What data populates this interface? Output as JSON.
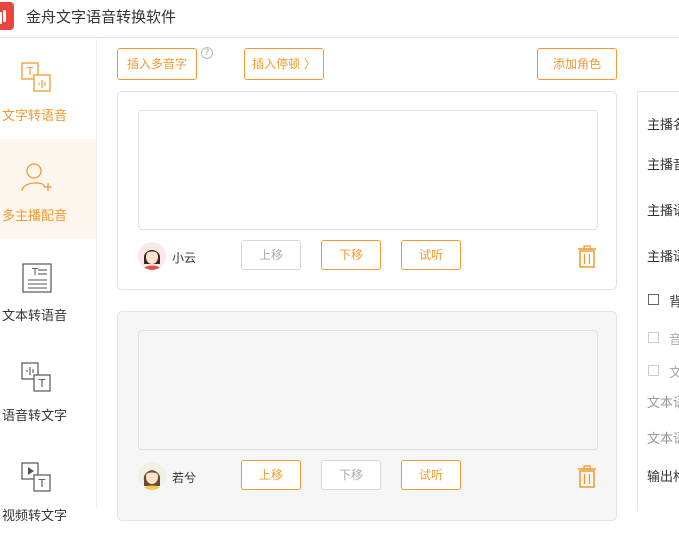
{
  "app": {
    "title": "金舟文字语音转换软件"
  },
  "sidebar": {
    "items": [
      {
        "label": "文字转语音",
        "icon": "text-to-speech-icon",
        "active": false
      },
      {
        "label": "多主播配音",
        "icon": "multi-anchor-icon",
        "active": true
      },
      {
        "label": "文本转语音",
        "icon": "document-icon",
        "active": false
      },
      {
        "label": "语音转文字",
        "icon": "speech-to-text-icon",
        "active": false
      },
      {
        "label": "视频转文字",
        "icon": "video-to-text-icon",
        "active": false
      }
    ]
  },
  "toolbar": {
    "insert_polyphone": "插入多音字",
    "insert_pause": "插入停顿 〉",
    "add_role": "添加角色",
    "help": "?"
  },
  "dialogs": [
    {
      "text": "",
      "speaker": "小云",
      "move_up": "上移",
      "move_down": "下移",
      "preview": "试听",
      "move_up_enabled": false,
      "move_down_enabled": true
    },
    {
      "text": "",
      "speaker": "若兮",
      "move_up": "上移",
      "move_down": "下移",
      "preview": "试听",
      "move_up_enabled": true,
      "move_down_enabled": false
    }
  ],
  "right_panel": {
    "rows": [
      "主播名",
      "主播音",
      "主播语",
      "主播语"
    ],
    "checks": [
      {
        "label": "背",
        "dim": false
      },
      {
        "label": "音",
        "dim": true
      },
      {
        "label": "文",
        "dim": true
      }
    ],
    "text_rows": [
      "文本语",
      "文本语"
    ],
    "output_label": "输出格"
  }
}
